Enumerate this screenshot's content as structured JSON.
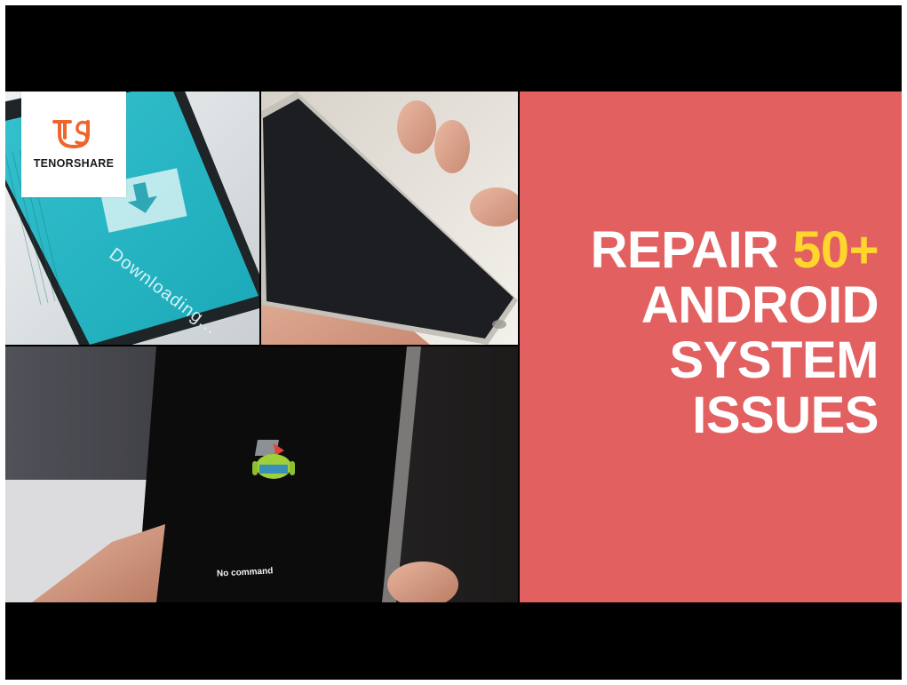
{
  "brand": {
    "name": "TENORSHARE",
    "accent": "#f0642d"
  },
  "panels": {
    "downloading": {
      "caption": "Downloading..."
    },
    "recovery": {
      "caption": "No command"
    }
  },
  "headline": {
    "word1": "REPAIR",
    "highlight": "50+",
    "line2": "ANDROID",
    "line3": "SYSTEM",
    "line4": "ISSUES",
    "text_color": "#ffffff",
    "highlight_color": "#ffd52e",
    "background": "#e26060"
  },
  "icons": [
    "tenorshare-logo-icon",
    "download-arrow-icon",
    "android-robot-icon"
  ]
}
